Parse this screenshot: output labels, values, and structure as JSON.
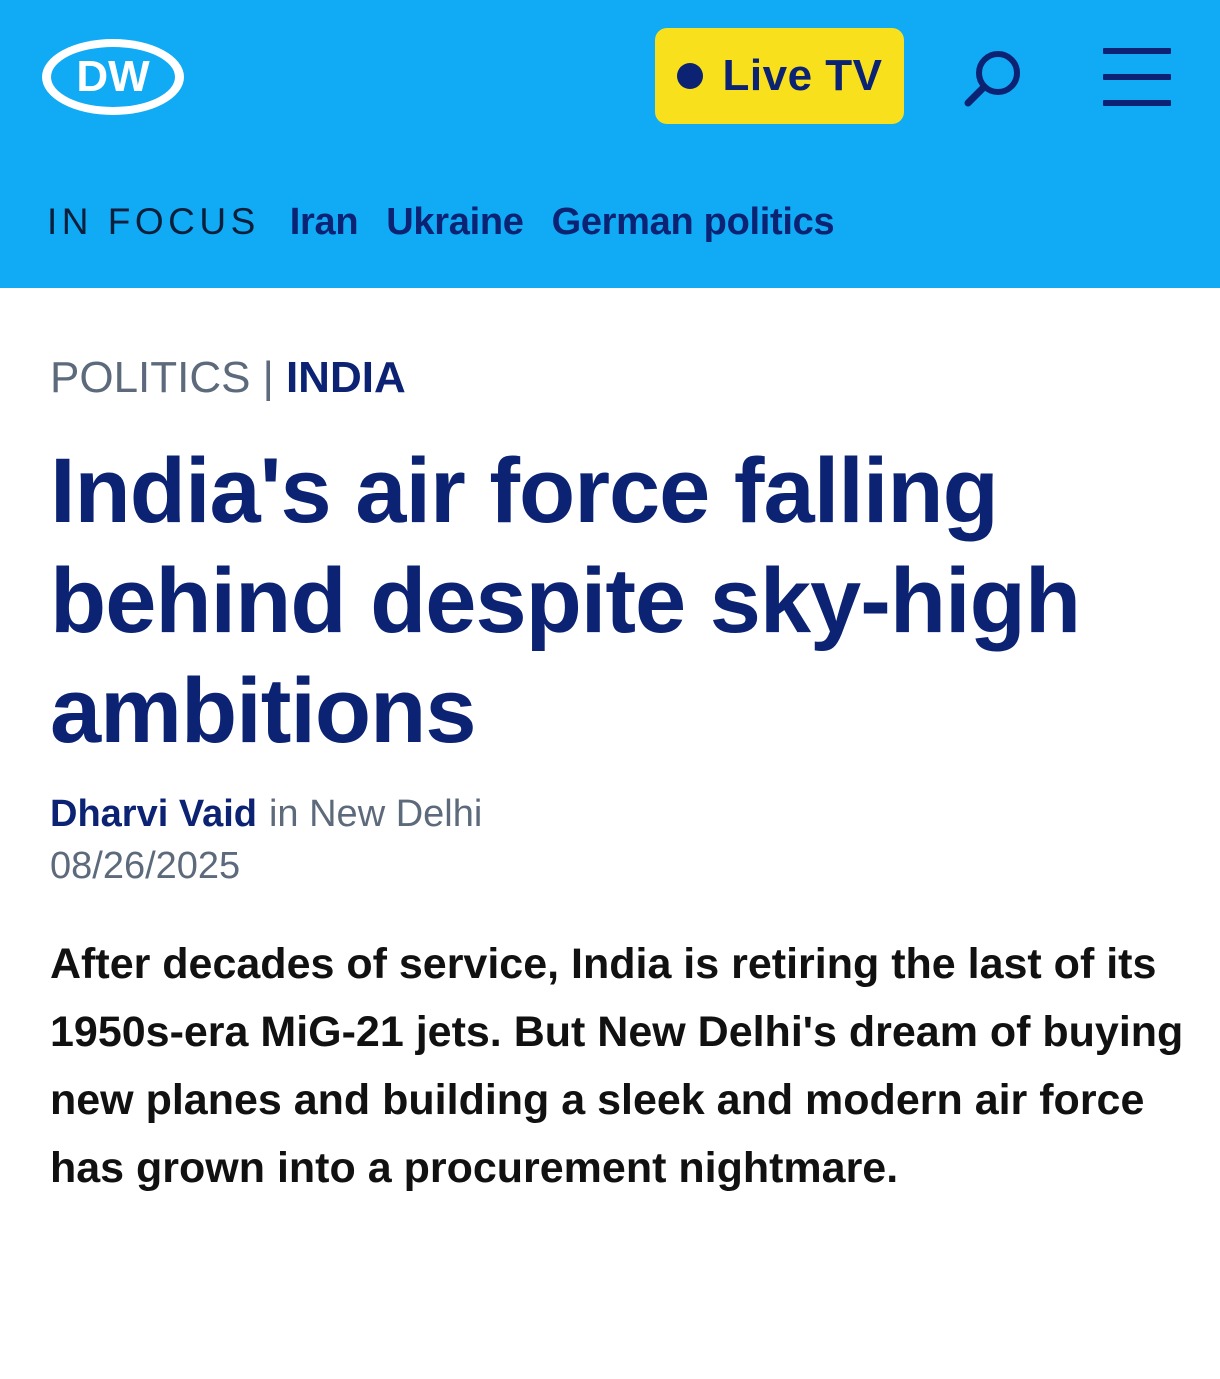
{
  "header": {
    "logo_text": "DW",
    "live_button_label": "Live TV",
    "background_color": "#11aaf5",
    "live_button_color": "#f8e11c",
    "brand_dark": "#0c2374",
    "search_icon": "search-icon",
    "menu_icon": "hamburger-menu-icon"
  },
  "in_focus": {
    "label": "IN FOCUS",
    "links": [
      "Iran",
      "Ukraine",
      "German politics"
    ]
  },
  "article": {
    "kicker_section": "POLITICS",
    "kicker_separator": "|",
    "kicker_region": "INDIA",
    "headline": "India's air force falling behind despite sky-high ambitions",
    "author": "Dharvi Vaid",
    "location": "in New Delhi",
    "date": "08/26/2025",
    "teaser": "After decades of service, India is retiring the last of its 1950s-era MiG-21 jets. But New Delhi's dream of buying new planes and building a sleek and modern air force has grown into a procurement nightmare."
  }
}
